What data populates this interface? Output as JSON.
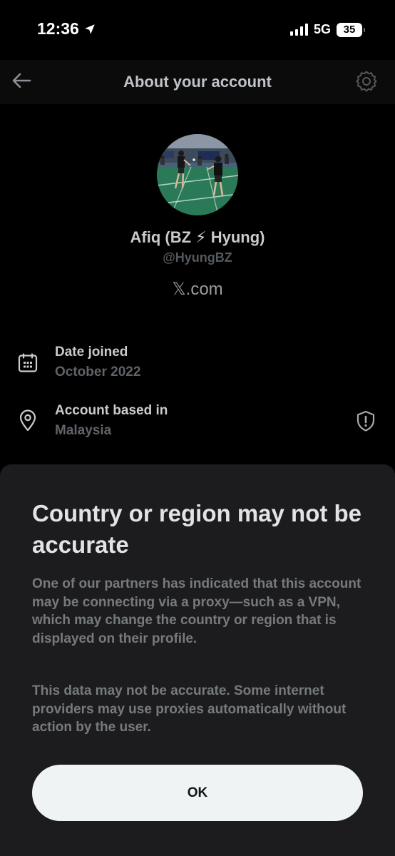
{
  "status_bar": {
    "time": "12:36",
    "network": "5G",
    "battery": "35"
  },
  "header": {
    "title": "About your account"
  },
  "profile": {
    "display_name": "Afiq (BZ ⚡ Hyung)",
    "username": "@HyungBZ",
    "site_glyph": "𝕏",
    "site_suffix": ".com"
  },
  "info": {
    "date_joined_label": "Date joined",
    "date_joined_value": "October 2022",
    "based_in_label": "Account based in",
    "based_in_value": "Malaysia"
  },
  "sheet": {
    "title": "Country or region may not be accurate",
    "paragraph_1": "One of our partners has indicated that this account may be connecting via a proxy—such as a VPN, which may change the country or region that is displayed on their profile.",
    "paragraph_2": "This data may not be accurate. Some internet providers may use proxies automatically without action by the user.",
    "ok_label": "OK"
  },
  "icons": {
    "back": "arrow-left-icon",
    "settings": "gear-icon",
    "calendar": "calendar-icon",
    "location": "location-pin-icon",
    "shield": "shield-alert-icon",
    "navigation": "location-arrow-icon"
  },
  "colors": {
    "background": "#000000",
    "header": "#0b0b0b",
    "sheet": "#1c1c1e",
    "button": "#eff3f4"
  }
}
